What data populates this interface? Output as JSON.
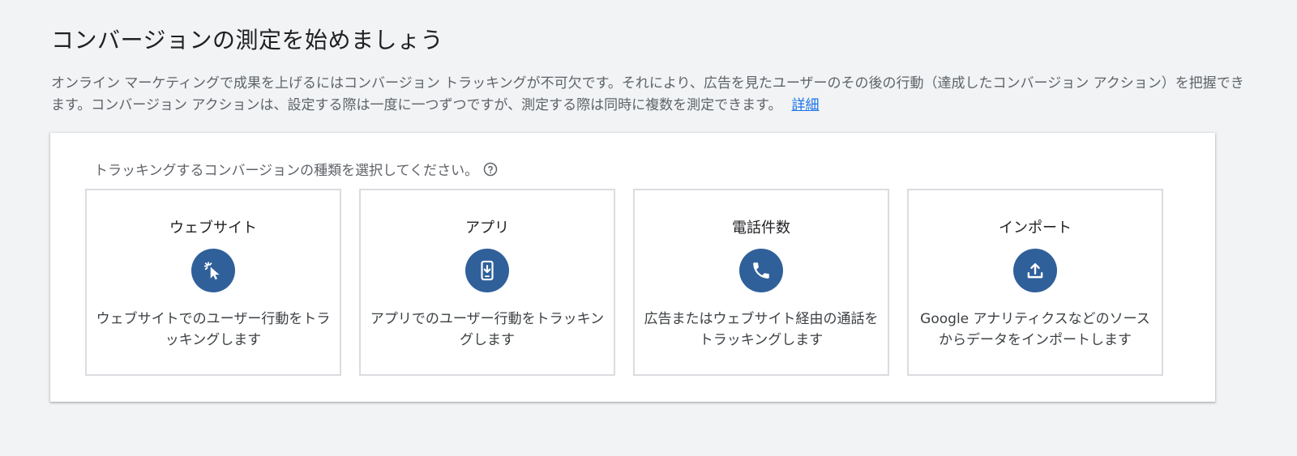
{
  "page": {
    "title": "コンバージョンの測定を始めましょう",
    "description": "オンライン マーケティングで成果を上げるにはコンバージョン トラッキングが不可欠です。それにより、広告を見たユーザーのその後の行動（達成したコンバージョン アクション）を把握できます。コンバージョン アクションは、設定する際は一度に一つずつですが、測定する際は同時に複数を測定できます。",
    "learn_more": "詳細"
  },
  "panel": {
    "prompt": "トラッキングするコンバージョンの種類を選択してください。",
    "help_icon": "help-circle-icon"
  },
  "cards": [
    {
      "title": "ウェブサイト",
      "icon": "cursor-click-icon",
      "description": "ウェブサイトでのユーザー行動をトラッキングします"
    },
    {
      "title": "アプリ",
      "icon": "phone-download-icon",
      "description": "アプリでのユーザー行動をトラッキングします"
    },
    {
      "title": "電話件数",
      "icon": "phone-call-icon",
      "description": "広告またはウェブサイト経由の通話をトラッキングします"
    },
    {
      "title": "インポート",
      "icon": "upload-icon",
      "description": "Google アナリティクスなどのソースからデータをインポートします"
    }
  ],
  "colors": {
    "icon_circle": "#30609a",
    "link": "#1a73e8",
    "background": "#f1f3f4"
  }
}
